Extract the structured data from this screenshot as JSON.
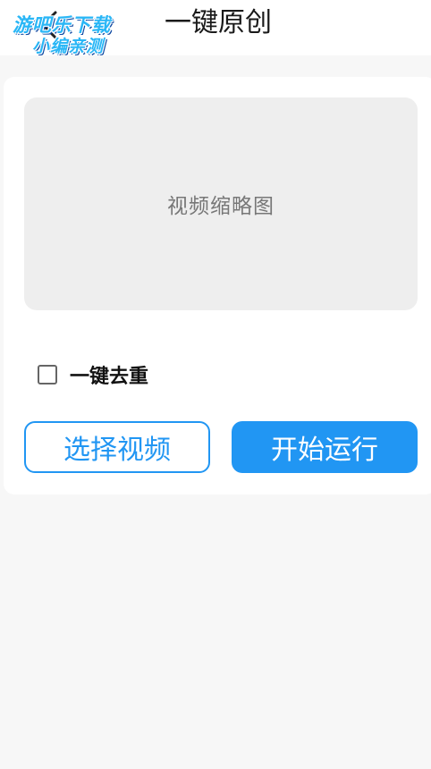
{
  "header": {
    "title": "一键原创",
    "back_icon": "chevron-left-icon"
  },
  "watermark": {
    "line1": "游吧乐下载",
    "line2": "小编亲测"
  },
  "thumbnail": {
    "placeholder": "视频缩略图"
  },
  "options": {
    "dedupe_label": "一键去重",
    "dedupe_checked": false
  },
  "actions": {
    "select_label": "选择视频",
    "start_label": "开始运行"
  },
  "colors": {
    "accent": "#2196f3",
    "page_bg": "#f7f7f7",
    "thumb_bg": "#eeeeee"
  }
}
